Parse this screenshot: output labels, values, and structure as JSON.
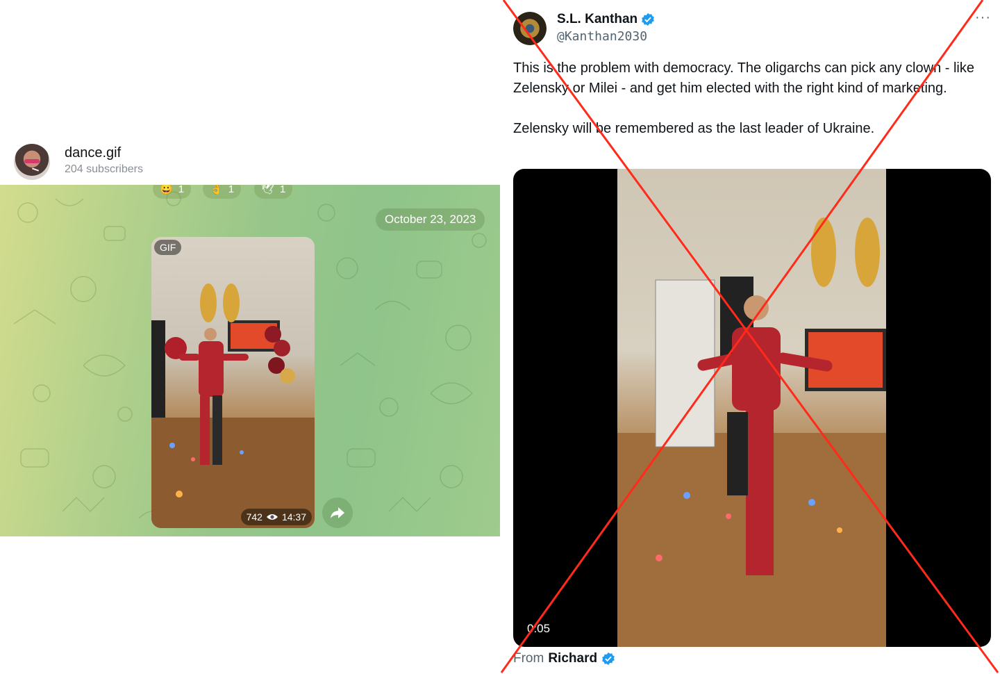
{
  "telegram": {
    "channel_name": "dance.gif",
    "subscribers": "204 subscribers",
    "reactions": [
      {
        "emoji": "😀",
        "count": "1"
      },
      {
        "emoji": "👌",
        "count": "1"
      },
      {
        "emoji": "🕊",
        "count": "1"
      }
    ],
    "date": "October 23, 2023",
    "gif_badge": "GIF",
    "views": "742",
    "time": "14:37"
  },
  "tweet": {
    "name": "S.L. Kanthan",
    "handle": "@Kanthan2030",
    "more": "···",
    "text": "This is the problem with democracy. The oligarchs can pick any clown - like Zelensky or Milei - and get him elected with the right kind of marketing.\n\nZelensky will be remembered as the last leader of Ukraine.",
    "video_time": "0:05",
    "from_label": "From",
    "from_name": "Richard"
  },
  "colors": {
    "verified_blue": "#1d9bf0",
    "cross_red": "#ff2a1a"
  }
}
